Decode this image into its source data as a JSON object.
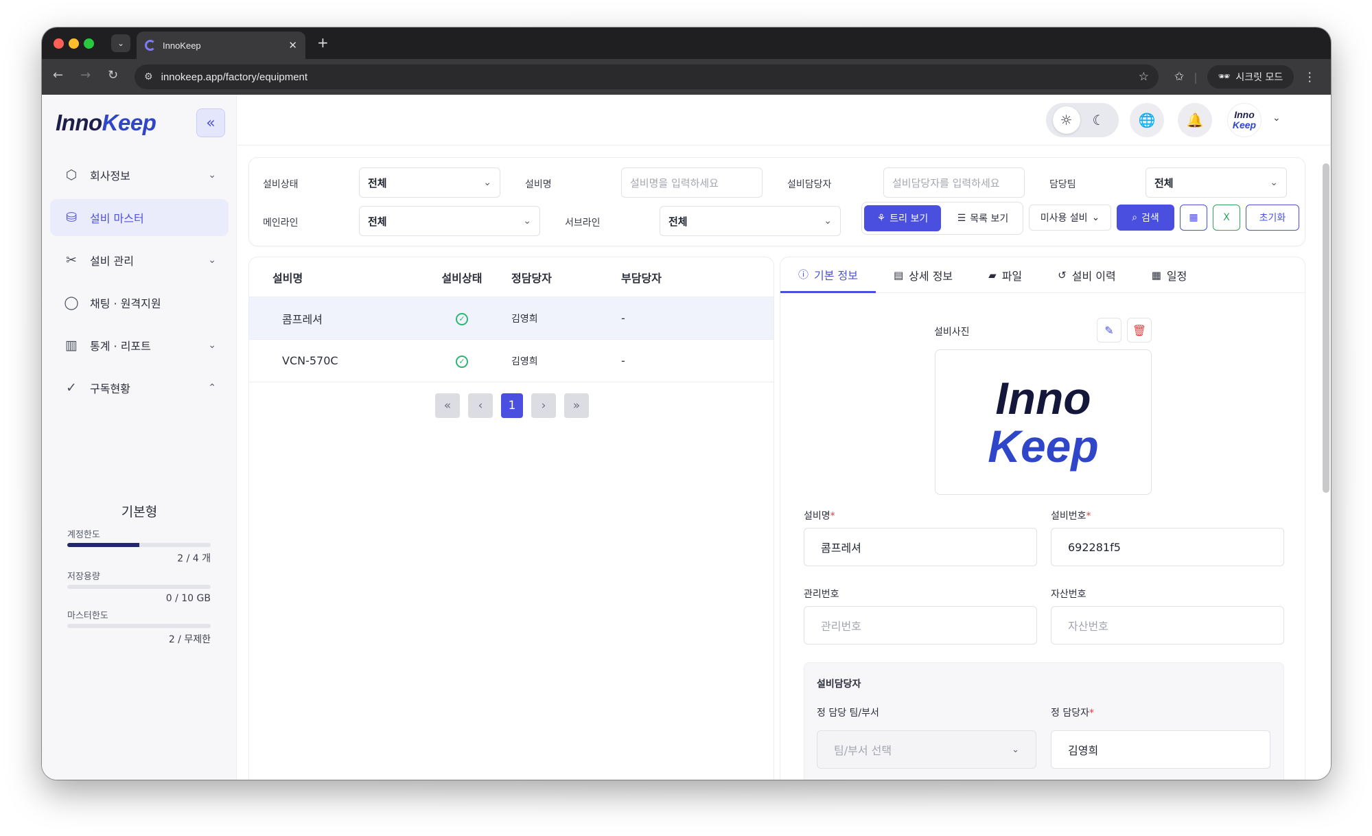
{
  "browser": {
    "tab_title": "InnoKeep",
    "url": "innokeep.app/factory/equipment",
    "incognito_label": "시크릿 모드"
  },
  "sidebar": {
    "logo_inno": "Inno",
    "logo_keep": "Keep",
    "menu": [
      {
        "label": "회사정보",
        "icon": "hexagon-icon",
        "expandable": true
      },
      {
        "label": "설비 마스터",
        "icon": "database-icon",
        "active": true
      },
      {
        "label": "설비 관리",
        "icon": "tools-icon",
        "expandable": true
      },
      {
        "label": "채팅 · 원격지원",
        "icon": "chat-icon"
      },
      {
        "label": "통계 · 리포트",
        "icon": "bar-chart-icon",
        "expandable": true
      },
      {
        "label": "구독현황",
        "icon": "check-circle-icon",
        "expanded": true
      }
    ],
    "plan": {
      "name": "기본형",
      "quotas": [
        {
          "label": "계정한도",
          "value": "2 / 4 개",
          "fraction": 0.5
        },
        {
          "label": "저장용량",
          "value": "0 / 10 GB",
          "fraction": 0
        },
        {
          "label": "마스터한도",
          "value": "2 / 무제한",
          "fraction": 0
        }
      ]
    }
  },
  "header": {
    "avatar_inno": "Inno",
    "avatar_keep": "Keep"
  },
  "filters": {
    "status_label": "설비상태",
    "status_value": "전체",
    "name_label": "설비명",
    "name_placeholder": "설비명을 입력하세요",
    "manager_label": "설비담당자",
    "manager_placeholder": "설비담당자를 입력하세요",
    "team_label": "담당팀",
    "team_value": "전체",
    "mainline_label": "메인라인",
    "mainline_value": "전체",
    "subline_label": "서브라인",
    "subline_value": "전체",
    "tree_view": "트리 보기",
    "list_view": "목록 보기",
    "unused": "미사용 설비",
    "search": "검색",
    "reset": "초기화"
  },
  "list": {
    "columns": [
      "설비명",
      "설비상태",
      "정담당자",
      "부담당자"
    ],
    "rows": [
      {
        "name": "콤프레셔",
        "status": "정상",
        "primary": "김영희",
        "secondary": "-"
      },
      {
        "name": "VCN-570C",
        "status": "정상",
        "primary": "김영희",
        "secondary": "-"
      }
    ],
    "pagination": {
      "first": "«",
      "prev": "‹",
      "current": "1",
      "next": "›",
      "last": "»"
    }
  },
  "detail": {
    "tabs": [
      "기본 정보",
      "상세 정보",
      "파일",
      "설비 이력",
      "일정"
    ],
    "photo_label": "설비사진",
    "photo_inno": "Inno",
    "photo_keep": "Keep",
    "fields": {
      "name_label": "설비명",
      "name_value": "콤프레셔",
      "number_label": "설비번호",
      "number_value": "692281f5",
      "mgmt_label": "관리번호",
      "mgmt_placeholder": "관리번호",
      "asset_label": "자산번호",
      "asset_placeholder": "자산번호"
    },
    "manager_section": {
      "title": "설비담당자",
      "team_label": "정 담당 팀/부서",
      "team_placeholder": "팀/부서 선택",
      "primary_label": "정 담당자",
      "primary_value": "김영희"
    }
  },
  "colors": {
    "accent": "#4a4fe0",
    "brand_dark": "#1d1f4a",
    "brand_blue": "#2f46c9",
    "status_ok": "#2bb673"
  }
}
